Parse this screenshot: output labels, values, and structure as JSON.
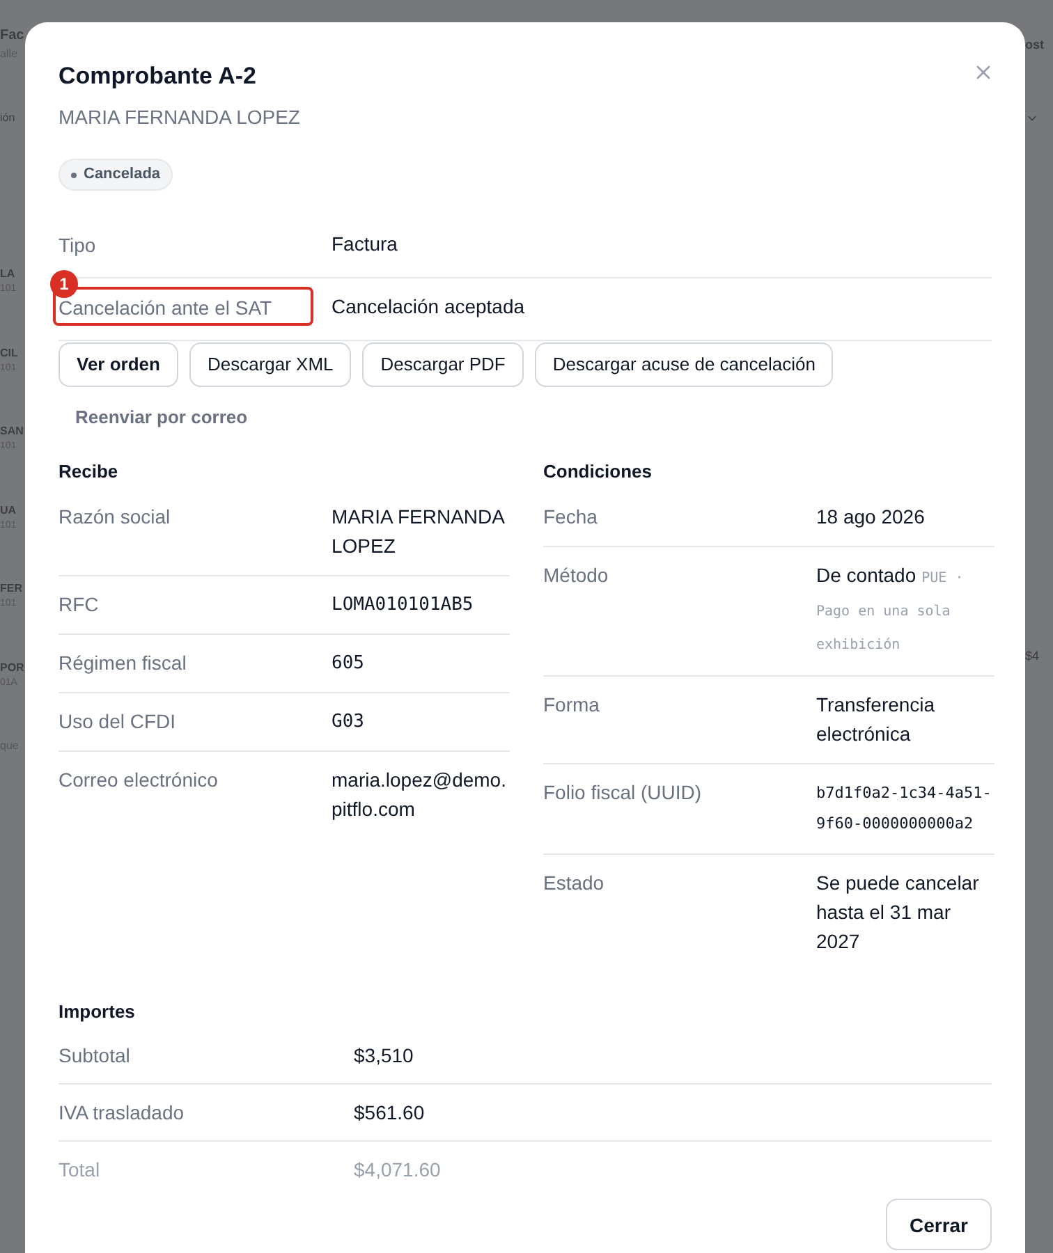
{
  "background": {
    "title": "Fac",
    "subtitle": "alle",
    "filter": "ión",
    "rows": [
      {
        "name": "LA",
        "code": "101"
      },
      {
        "name": "CIL",
        "code": "101"
      },
      {
        "name": "SAN",
        "code": "101"
      },
      {
        "name": "UA",
        "code": "101"
      },
      {
        "name": "FER",
        "code": "101"
      },
      {
        "name": "POR",
        "code": "01A"
      }
    ],
    "footer": "que",
    "right_header": "ost",
    "right_amount": "$4"
  },
  "dialog": {
    "title": "Comprobante A-2",
    "subtitle": "MARIA FERNANDA LOPEZ",
    "status": "Cancelada",
    "summary": [
      {
        "label": "Tipo",
        "value": "Factura",
        "highlighted": false
      },
      {
        "label": "Cancelación ante el SAT",
        "value": "Cancelación aceptada",
        "highlighted": true,
        "callout": "1"
      }
    ],
    "actions": [
      "Ver orden",
      "Descargar XML",
      "Descargar PDF",
      "Descargar acuse de cancelación"
    ],
    "link": "Reenviar por correo",
    "sections": [
      {
        "title": "Recibe",
        "rows": [
          {
            "label": "Razón social",
            "value": "MARIA FERNANDA LOPEZ",
            "kind": "text"
          },
          {
            "label": "RFC",
            "value": "LOMA010101AB5",
            "kind": "mono"
          },
          {
            "label": "Régimen fiscal",
            "value": "605",
            "kind": "mono"
          },
          {
            "label": "Uso del CFDI",
            "value": "G03",
            "kind": "mono"
          },
          {
            "label": "Correo electrónico",
            "value": "maria.lopez@demo.pitflo.com",
            "kind": "text"
          }
        ]
      },
      {
        "title": "Condiciones",
        "rows": [
          {
            "label": "Fecha",
            "value": "18 ago 2026",
            "kind": "text"
          },
          {
            "label": "Método",
            "value": "De contado",
            "detail": "PUE · Pago en una sola exhibición",
            "kind": "text"
          },
          {
            "label": "Forma",
            "value": "Transferencia electrónica",
            "kind": "text"
          },
          {
            "label": "Folio fiscal (UUID)",
            "value": "b7d1f0a2-1c34-4a51-9f60-0000000000a2",
            "kind": "code"
          },
          {
            "label": "Estado",
            "value": "Se puede cancelar hasta el 31 mar 2027",
            "kind": "text"
          }
        ]
      }
    ],
    "totals": {
      "title": "Importes",
      "rows": [
        {
          "label": "Subtotal",
          "value": "$3,510",
          "faded": false
        },
        {
          "label": "IVA trasladado",
          "value": "$561.60",
          "faded": false
        },
        {
          "label": "Total",
          "value": "$4,071.60",
          "faded": true
        }
      ]
    },
    "close_button": "Cerrar"
  }
}
